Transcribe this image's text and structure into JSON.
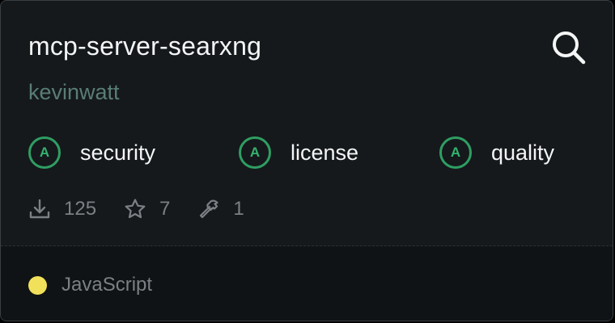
{
  "repo": {
    "name": "mcp-server-searxng",
    "author": "kevinwatt"
  },
  "grades": [
    {
      "letter": "A",
      "label": "security"
    },
    {
      "letter": "A",
      "label": "license"
    },
    {
      "letter": "A",
      "label": "quality"
    }
  ],
  "stats": {
    "downloads": "125",
    "stars": "7",
    "tools": "1"
  },
  "language": {
    "name": "JavaScript",
    "color": "#f1e05a"
  },
  "icons": {
    "search": "search-icon",
    "downloads": "download-icon",
    "stars": "star-icon",
    "tools": "hammer-icon"
  },
  "colors": {
    "grade_accent": "#2f9e62",
    "author": "#5a7d73"
  }
}
